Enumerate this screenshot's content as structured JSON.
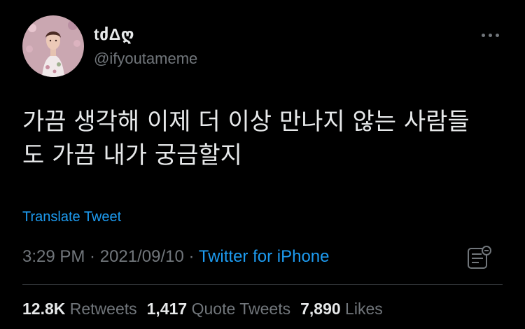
{
  "user": {
    "display_name": "tძΔღ",
    "handle": "@ifyoutameme",
    "avatar": "avatar-painting"
  },
  "tweet": {
    "text": "가끔 생각해 이제 더 이상 만나지 않는 사람들\n도 가끔 내가 궁금할지",
    "translate_label": "Translate Tweet",
    "time": "3:29 PM",
    "separator": " · ",
    "date": "2021/09/10",
    "source": "Twitter for iPhone"
  },
  "stats": {
    "retweets_count": "12.8K",
    "retweets_label": "Retweets",
    "quotes_count": "1,417",
    "quotes_label": "Quote Tweets",
    "likes_count": "7,890",
    "likes_label": "Likes"
  },
  "icons": {
    "more": "more-icon",
    "analytics": "analytics-icon"
  },
  "colors": {
    "background": "#000000",
    "text": "#e7e9ea",
    "secondary": "#71767b",
    "link": "#1d9bf0",
    "divider": "#2f3336"
  }
}
